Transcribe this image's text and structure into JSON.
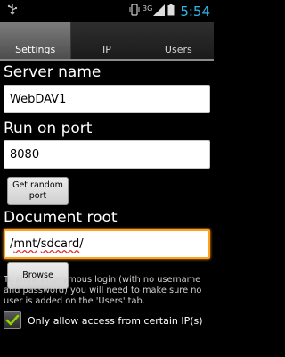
{
  "status": {
    "network_label": "3G",
    "time": "5:54",
    "icons": [
      "usb-icon",
      "vibrate-icon",
      "signal-icon",
      "battery-icon"
    ]
  },
  "tabs": [
    {
      "label": "Settings",
      "active": true
    },
    {
      "label": "IP",
      "active": false
    },
    {
      "label": "Users",
      "active": false
    }
  ],
  "server_name": {
    "label": "Server name",
    "value": "WebDAV1"
  },
  "port": {
    "label": "Run on port",
    "value": "8080",
    "random_button": "Get random port"
  },
  "doc_root": {
    "label": "Document root",
    "value_parts": [
      "/",
      "mnt",
      "/",
      "sdcard",
      "/"
    ],
    "browse_button": "Browse"
  },
  "info_text": "To allow anonymous login (with no username and password) you will need to make sure no user is added on the 'Users' tab.",
  "ip_restrict": {
    "label": "Only allow access from certain IP(s)",
    "checked": true
  },
  "colors": {
    "accent": "#2fb6e8",
    "focus": "#ff9f1a",
    "check": "#8fd400"
  }
}
